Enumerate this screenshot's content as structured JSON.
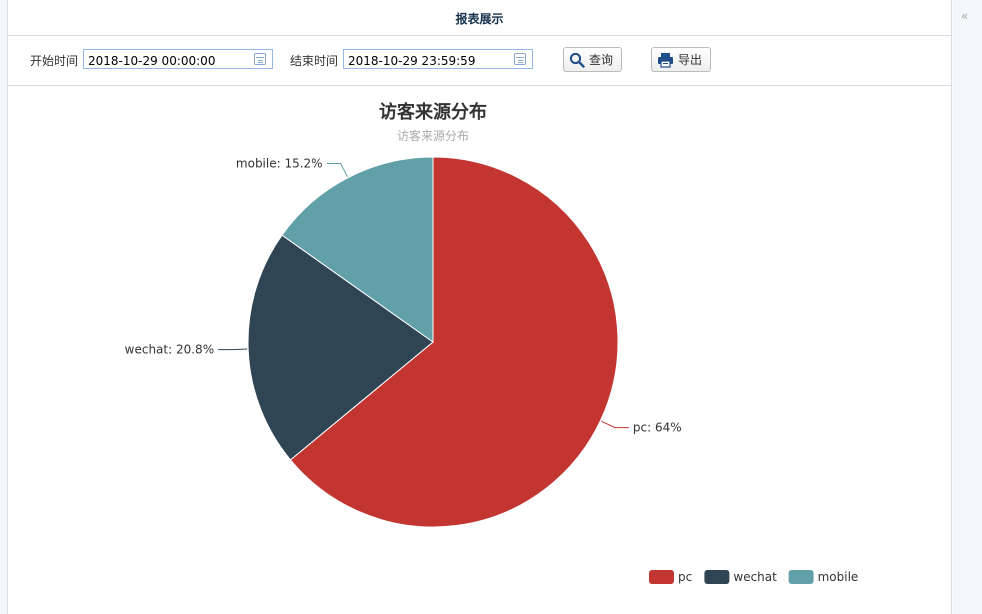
{
  "header": {
    "title": "报表展示"
  },
  "rail": {
    "collapse_glyph": "«"
  },
  "toolbar": {
    "start_label": "开始时间",
    "start_value": "2018-10-29 00:00:00",
    "end_label": "结束时间",
    "end_value": "2018-10-29 23:59:59",
    "query_label": "查询",
    "export_label": "导出"
  },
  "icons": {
    "query": "search-icon",
    "export": "printer-icon",
    "date": "calendar-icon"
  },
  "chart_data": {
    "type": "pie",
    "title": "访客来源分布",
    "subtitle": "访客来源分布",
    "legend_position": "bottom-right",
    "slices": [
      {
        "name": "pc",
        "percent": 64,
        "label": "pc: 64%",
        "color": "#c23531"
      },
      {
        "name": "wechat",
        "percent": 20.8,
        "label": "wechat: 20.8%",
        "color": "#2f4554"
      },
      {
        "name": "mobile",
        "percent": 15.2,
        "label": "mobile: 15.2%",
        "color": "#61a0a8"
      }
    ]
  }
}
